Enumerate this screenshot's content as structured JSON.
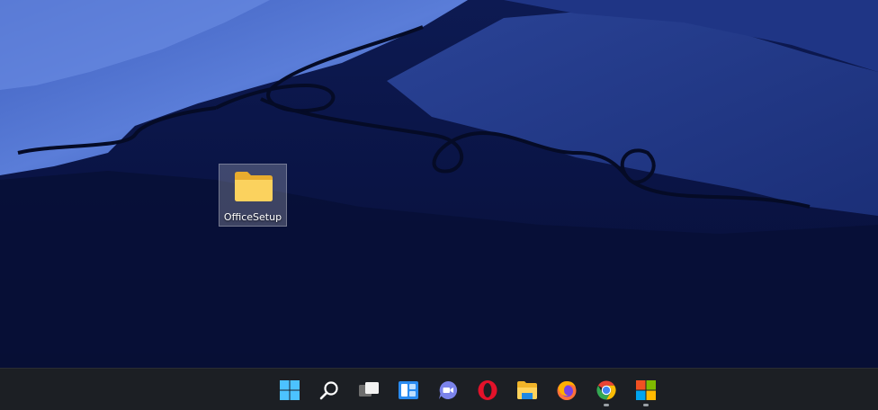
{
  "desktop": {
    "icons": [
      {
        "label": "OfficeSetup",
        "icon": "folder-icon",
        "selected": true
      }
    ]
  },
  "taskbar": {
    "items": [
      {
        "icon": "windows-start-icon",
        "running": false
      },
      {
        "icon": "search-icon",
        "running": false
      },
      {
        "icon": "task-view-icon",
        "running": false
      },
      {
        "icon": "widgets-icon",
        "running": false
      },
      {
        "icon": "teams-chat-icon",
        "running": false
      },
      {
        "icon": "opera-icon",
        "running": false
      },
      {
        "icon": "file-explorer-icon",
        "running": false
      },
      {
        "icon": "firefox-icon",
        "running": false
      },
      {
        "icon": "chrome-icon",
        "running": true
      },
      {
        "icon": "microsoft-store-icon",
        "running": true
      }
    ]
  },
  "colors": {
    "taskbar_bg": "#1c1f24",
    "wallpaper_base": "#0a1440",
    "snow": "#4f6ecb",
    "folder_yellow": "#f8c94a"
  }
}
